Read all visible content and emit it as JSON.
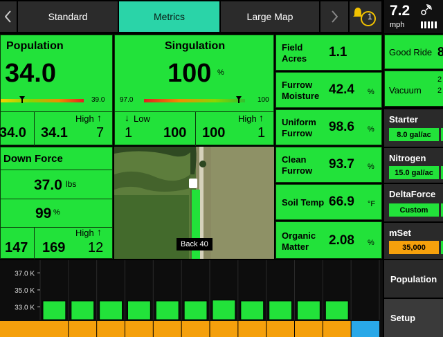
{
  "tabs": [
    {
      "label": "Standard"
    },
    {
      "label": "Metrics"
    },
    {
      "label": "Large Map"
    }
  ],
  "alerts": {
    "count": "1"
  },
  "speed": {
    "value": "7.2",
    "unit": "mph"
  },
  "population": {
    "title": "Population",
    "value": "34.0",
    "bar_max": "39.0",
    "bar_fraction": 0.25,
    "low_value": "34.0",
    "avg_value": "34.1",
    "high_label": "High",
    "high_value": "7"
  },
  "singulation": {
    "title": "Singulation",
    "value": "100",
    "unit": "%",
    "bar_min": "97.0",
    "bar_max": "100",
    "bar_fraction": 0.93,
    "low_label": "Low",
    "low_count": "1",
    "low_value": "100",
    "avg_value": "100",
    "high_label": "High",
    "high_value": "1"
  },
  "down_force": {
    "title": "Down Force",
    "value": "37.0",
    "unit": "lbs",
    "percent": "99",
    "percent_unit": "%",
    "low_value": "147",
    "avg_value": "169",
    "high_label": "High",
    "high_value": "12"
  },
  "map": {
    "label": "Back 40"
  },
  "metrics": [
    {
      "label1": "Field",
      "label2": "Acres",
      "value": "1.1",
      "unit": ""
    },
    {
      "label1": "Furrow",
      "label2": "Moisture",
      "value": "42.4",
      "unit": "%"
    },
    {
      "label1": "Uniform",
      "label2": "Furrow",
      "value": "98.6",
      "unit": "%"
    },
    {
      "label1": "Clean",
      "label2": "Furrow",
      "value": "93.7",
      "unit": "%"
    },
    {
      "label1": "Soil Temp",
      "label2": "",
      "value": "66.9",
      "unit": "°F"
    },
    {
      "label1": "Organic",
      "label2": "Matter",
      "value": "2.08",
      "unit": "%"
    }
  ],
  "side": {
    "good_ride": {
      "label": "Good Ride",
      "value": "8"
    },
    "vacuum": {
      "label": "Vacuum",
      "value1": "2",
      "value2": "2"
    },
    "starter": {
      "label": "Starter",
      "value": "8.0 gal/ac"
    },
    "nitrogen": {
      "label": "Nitrogen",
      "value": "15.0 gal/ac"
    },
    "deltaforce": {
      "label": "DeltaForce",
      "value": "Custom"
    },
    "mset": {
      "label": "mSet",
      "value": "35,000"
    },
    "population_button": "Population",
    "setup_button": "Setup"
  },
  "colors": {
    "panel_green": "#22e23a",
    "accent_teal": "#2ad4a8",
    "orange": "#f5a00c",
    "blue": "#29a8e8"
  },
  "chart_data": {
    "type": "bar",
    "ylabels": [
      "37.0 K",
      "35.0 K",
      "33.0 K"
    ],
    "yticks": [
      37.0,
      35.0,
      33.0
    ],
    "ylim": [
      31.5,
      38.0
    ],
    "values": [
      33.7,
      33.7,
      33.7,
      33.7,
      33.7,
      33.7,
      33.8,
      33.7,
      33.7,
      33.7,
      33.7
    ],
    "units": "K seeds/ac"
  }
}
